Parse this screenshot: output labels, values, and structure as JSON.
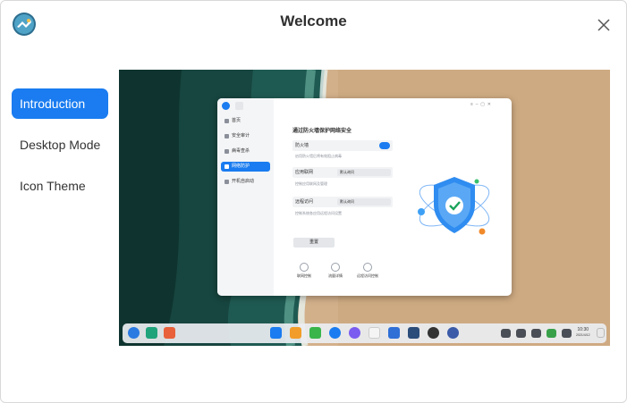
{
  "window": {
    "title": "Welcome",
    "close_icon": "close-icon",
    "logo_icon": "deepin-logo-icon"
  },
  "nav": {
    "items": [
      {
        "label": "Introduction",
        "active": true
      },
      {
        "label": "Desktop Mode",
        "active": false
      },
      {
        "label": "Icon Theme",
        "active": false
      }
    ]
  },
  "preview": {
    "app": {
      "sidebar": [
        "首页",
        "安全审计",
        "病毒查杀",
        "网络防护",
        "开机自启动"
      ],
      "selected_sidebar_index": 3,
      "heading": "通过防火墙保护网络安全",
      "firewall_label": "防火墙",
      "firewall_desc": "启用防火墙后将有效阻止病毒",
      "app_network_label": "应用联网",
      "app_network_value": "默认询问",
      "app_network_desc": "控制应用联网及管理",
      "remote_access_label": "远程访问",
      "remote_access_value": "默认询问",
      "remote_access_desc": "控制系统各应用远程访问设置",
      "reset_button": "重置",
      "footer_items": [
        "联网控制",
        "流量详情",
        "远程访问控制"
      ]
    },
    "dock": {
      "clock_time": "10:30",
      "clock_date": "2021/4/12"
    }
  },
  "colors": {
    "accent": "#1a7cf0"
  }
}
